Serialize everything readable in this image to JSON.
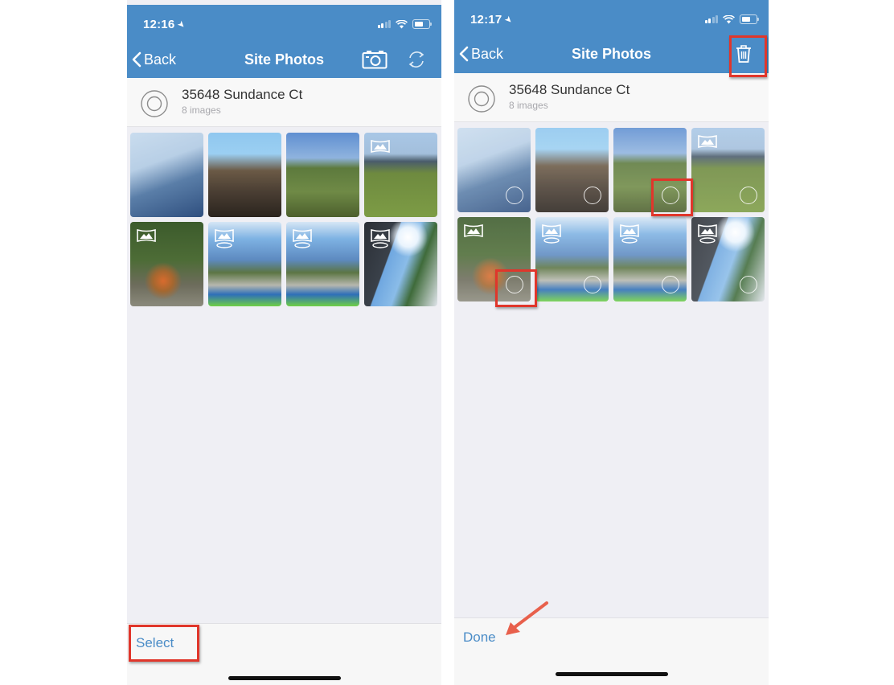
{
  "screens": [
    {
      "status": {
        "time": "12:16"
      },
      "nav": {
        "back_label": "Back",
        "title": "Site Photos",
        "right_icons": [
          "camera-icon",
          "refresh-icon"
        ]
      },
      "site": {
        "name": "35648 Sundance Ct",
        "count": "8 images"
      },
      "photos": [
        {
          "subject": "scaffolded building",
          "panorama": false
        },
        {
          "subject": "building frame under construction",
          "panorama": false
        },
        {
          "subject": "grassy lot with trees",
          "panorama": false
        },
        {
          "subject": "field with hills",
          "panorama": true
        },
        {
          "subject": "wooded path",
          "panorama": true
        },
        {
          "subject": "360 plaza with palm trees",
          "panorama": true,
          "spherical": true
        },
        {
          "subject": "360 road with trees",
          "panorama": true,
          "spherical": true
        },
        {
          "subject": "360 sunny street",
          "panorama": true,
          "spherical": true
        }
      ],
      "toolbar": {
        "button_label": "Select"
      }
    },
    {
      "status": {
        "time": "12:17"
      },
      "nav": {
        "back_label": "Back",
        "title": "Site Photos",
        "right_icons": [
          "trash-icon"
        ]
      },
      "site": {
        "name": "35648 Sundance Ct",
        "count": "8 images"
      },
      "selection_mode": true,
      "highlighted_photos": [
        3,
        5
      ],
      "toolbar": {
        "button_label": "Done"
      }
    }
  ],
  "annotations": {
    "highlight_color": "#e0362b",
    "arrow_color": "#e8604c",
    "highlighted": [
      "Select button",
      "Trash button",
      "Photo 3 select circle",
      "Photo 5 select circle"
    ],
    "arrow_target": "Done button"
  },
  "colors": {
    "header": "#4a8cc7",
    "link": "#4a8cc7",
    "background": "#efeff4"
  }
}
